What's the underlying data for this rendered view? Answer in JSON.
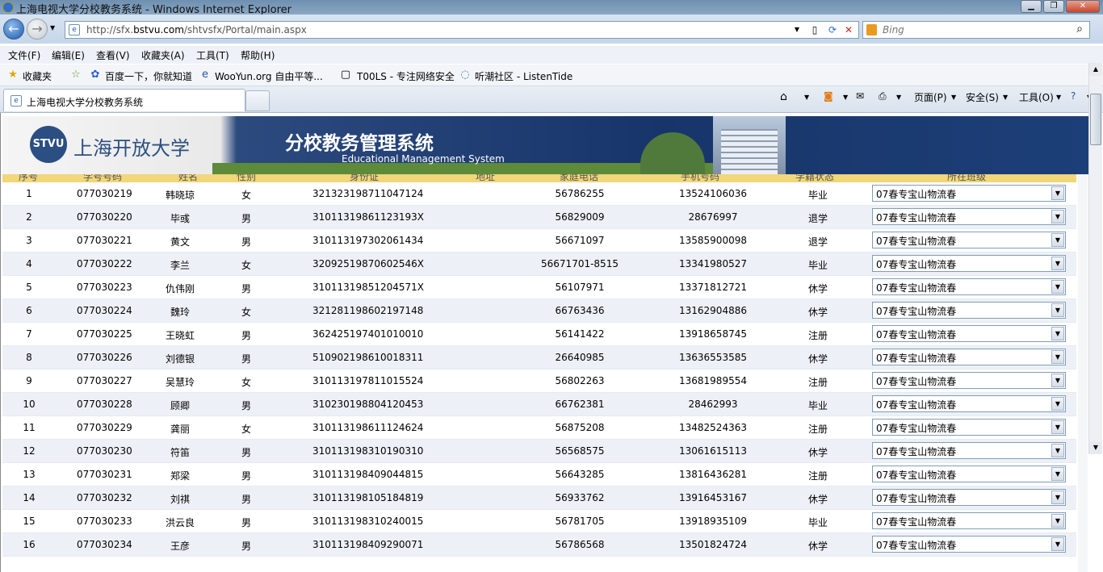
{
  "window": {
    "title": "上海电视大学分校教务系统 - Windows Internet Explorer"
  },
  "address": {
    "url_prefix": "http://sfx.",
    "url_domain": "bstvu.com",
    "url_path": "/shtvsfx/Portal/main.aspx"
  },
  "search": {
    "placeholder": "Bing"
  },
  "menu": [
    "文件(F)",
    "编辑(E)",
    "查看(V)",
    "收藏夹(A)",
    "工具(T)",
    "帮助(H)"
  ],
  "favorites": {
    "label": "收藏夹",
    "items": [
      "百度一下，你就知道",
      "WooYun.org  自由平等...",
      "T00LS - 专注网络安全",
      "听潮社区 - ListenTide"
    ]
  },
  "tab": {
    "title": "上海电视大学分校教务系统"
  },
  "commands": {
    "page": "页面(P)",
    "safety": "安全(S)",
    "tools": "工具(O)"
  },
  "banner": {
    "logo": "STVU",
    "university": "上海开放大学",
    "system": "分校教务管理系统",
    "system_en": "Educational Management System"
  },
  "columns": [
    "序号",
    "学号号码",
    "姓名",
    "性别",
    "身份证",
    "地址",
    "家庭电话",
    "手机号码",
    "学籍状态",
    "所在班级"
  ],
  "rows": [
    {
      "no": "1",
      "id": "077030219",
      "name": "韩晓琼",
      "sex": "女",
      "idcard": "321323198711047124",
      "tel": "56786255",
      "mobile": "13524106036",
      "status": "毕业",
      "class": "07春专宝山物流春"
    },
    {
      "no": "2",
      "id": "077030220",
      "name": "毕彧",
      "sex": "男",
      "idcard": "31011319861123193X",
      "tel": "56829009",
      "mobile": "28676997",
      "status": "退学",
      "class": "07春专宝山物流春"
    },
    {
      "no": "3",
      "id": "077030221",
      "name": "黄文",
      "sex": "男",
      "idcard": "310113197302061434",
      "tel": "56671097",
      "mobile": "13585900098",
      "status": "退学",
      "class": "07春专宝山物流春"
    },
    {
      "no": "4",
      "id": "077030222",
      "name": "李兰",
      "sex": "女",
      "idcard": "32092519870602546X",
      "tel": "56671701-8515",
      "mobile": "13341980527",
      "status": "毕业",
      "class": "07春专宝山物流春"
    },
    {
      "no": "5",
      "id": "077030223",
      "name": "仇伟刚",
      "sex": "男",
      "idcard": "31011319851204571X",
      "tel": "56107971",
      "mobile": "13371812721",
      "status": "休学",
      "class": "07春专宝山物流春"
    },
    {
      "no": "6",
      "id": "077030224",
      "name": "魏玲",
      "sex": "女",
      "idcard": "321281198602197148",
      "tel": "66763436",
      "mobile": "13162904886",
      "status": "休学",
      "class": "07春专宝山物流春"
    },
    {
      "no": "7",
      "id": "077030225",
      "name": "王晓虹",
      "sex": "男",
      "idcard": "362425197401010010",
      "tel": "56141422",
      "mobile": "13918658745",
      "status": "注册",
      "class": "07春专宝山物流春"
    },
    {
      "no": "8",
      "id": "077030226",
      "name": "刘德银",
      "sex": "男",
      "idcard": "510902198610018311",
      "tel": "26640985",
      "mobile": "13636553585",
      "status": "休学",
      "class": "07春专宝山物流春"
    },
    {
      "no": "9",
      "id": "077030227",
      "name": "吴慧玲",
      "sex": "女",
      "idcard": "310113197811015524",
      "tel": "56802263",
      "mobile": "13681989554",
      "status": "注册",
      "class": "07春专宝山物流春"
    },
    {
      "no": "10",
      "id": "077030228",
      "name": "顾卿",
      "sex": "男",
      "idcard": "310230198804120453",
      "tel": "66762381",
      "mobile": "28462993",
      "status": "毕业",
      "class": "07春专宝山物流春"
    },
    {
      "no": "11",
      "id": "077030229",
      "name": "龚丽",
      "sex": "女",
      "idcard": "310113198611124624",
      "tel": "56875208",
      "mobile": "13482524363",
      "status": "注册",
      "class": "07春专宝山物流春"
    },
    {
      "no": "12",
      "id": "077030230",
      "name": "符笛",
      "sex": "男",
      "idcard": "310113198310190310",
      "tel": "56568575",
      "mobile": "13061615113",
      "status": "休学",
      "class": "07春专宝山物流春"
    },
    {
      "no": "13",
      "id": "077030231",
      "name": "郑梁",
      "sex": "男",
      "idcard": "310113198409044815",
      "tel": "56643285",
      "mobile": "13816436281",
      "status": "注册",
      "class": "07春专宝山物流春"
    },
    {
      "no": "14",
      "id": "077030232",
      "name": "刘祺",
      "sex": "男",
      "idcard": "310113198105184819",
      "tel": "56933762",
      "mobile": "13916453167",
      "status": "休学",
      "class": "07春专宝山物流春"
    },
    {
      "no": "15",
      "id": "077030233",
      "name": "洪云良",
      "sex": "男",
      "idcard": "310113198310240015",
      "tel": "56781705",
      "mobile": "13918935109",
      "status": "毕业",
      "class": "07春专宝山物流春"
    },
    {
      "no": "16",
      "id": "077030234",
      "name": "王彦",
      "sex": "男",
      "idcard": "310113198409290071",
      "tel": "56786568",
      "mobile": "13501824724",
      "status": "休学",
      "class": "07春专宝山物流春"
    }
  ]
}
